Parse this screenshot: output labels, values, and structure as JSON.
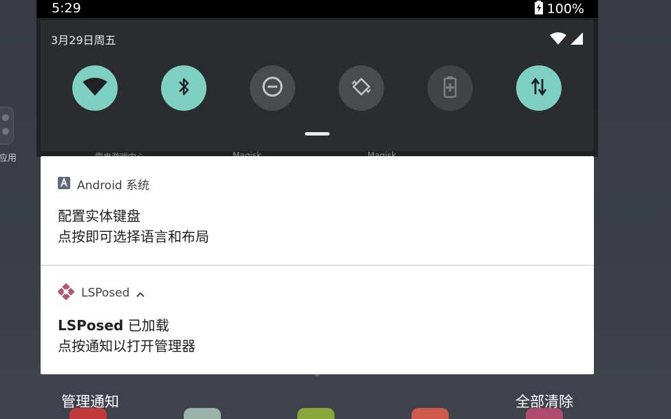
{
  "status_bar": {
    "time": "5:29",
    "battery": "100%"
  },
  "quick_settings": {
    "date": "3月29日周五",
    "tiles": [
      {
        "name": "wifi",
        "state": "on",
        "icon": "wifi-icon"
      },
      {
        "name": "bluetooth",
        "state": "on",
        "icon": "bluetooth-icon"
      },
      {
        "name": "dnd",
        "state": "off",
        "icon": "do-not-disturb-icon"
      },
      {
        "name": "auto-rotate",
        "state": "off",
        "icon": "rotate-icon"
      },
      {
        "name": "battery-saver",
        "state": "off",
        "icon": "battery-saver-icon"
      },
      {
        "name": "mobile-data",
        "state": "on",
        "icon": "data-transfer-icon"
      }
    ]
  },
  "background": {
    "side_label": "应用",
    "peek_labels": [
      "雷电游戏中心",
      "Magisk",
      "Magisk"
    ]
  },
  "notifications": [
    {
      "app": "Android 系统",
      "title": "配置实体键盘",
      "text": "点按即可选择语言和布局"
    },
    {
      "app": "LSPosed",
      "title_bold": "LSPosed",
      "title_rest": " 已加载",
      "text": "点按通知以打开管理器"
    }
  ],
  "footer": {
    "manage": "管理通知",
    "clear_all": "全部清除"
  },
  "colors": {
    "tile_on": "#7ed0c3",
    "tile_off": "#4a4b4f",
    "lsposed": "#b4566e"
  }
}
